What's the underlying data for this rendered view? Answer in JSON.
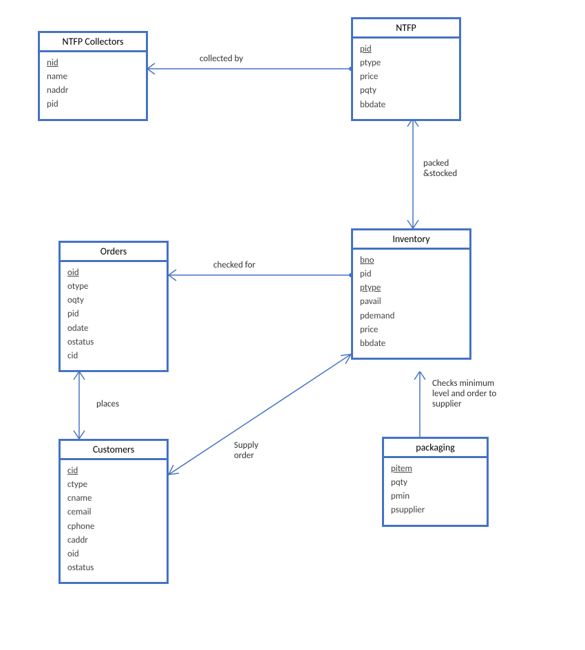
{
  "entities": {
    "ntfp_collectors": {
      "title": "NTFP Collectors",
      "attrs": [
        "nid",
        "name",
        "naddr",
        "pid"
      ],
      "pk": [
        "nid"
      ]
    },
    "ntfp": {
      "title": "NTFP",
      "attrs": [
        "pid",
        "ptype",
        "price",
        "pqty",
        "bbdate"
      ],
      "pk": [
        "pid"
      ]
    },
    "orders": {
      "title": "Orders",
      "attrs": [
        "oid",
        "otype",
        "oqty",
        "pid",
        "odate",
        "ostatus",
        "cid"
      ],
      "pk": [
        "oid"
      ]
    },
    "inventory": {
      "title": "Inventory",
      "attrs": [
        "bno",
        "pid",
        "ptype",
        "pavail",
        "pdemand",
        "price",
        "bbdate"
      ],
      "pk": [
        "bno",
        "ptype"
      ]
    },
    "customers": {
      "title": "Customers",
      "attrs": [
        "cid",
        "ctype",
        "cname",
        "cemail",
        "cphone",
        "caddr",
        "oid",
        "ostatus"
      ],
      "pk": [
        "cid"
      ]
    },
    "packaging": {
      "title": "packaging",
      "attrs": [
        "pitem",
        "pqty",
        "pmin",
        "psupplier"
      ],
      "pk": [
        "pitem"
      ]
    }
  },
  "relationships": {
    "collected_by": "collected by",
    "packed_stocked": "packed\n&stocked",
    "checked_for": "checked for",
    "places": "places",
    "supply_order": "Supply\norder",
    "checks_min": "Checks minimum\nlevel and order to\nsupplier"
  }
}
